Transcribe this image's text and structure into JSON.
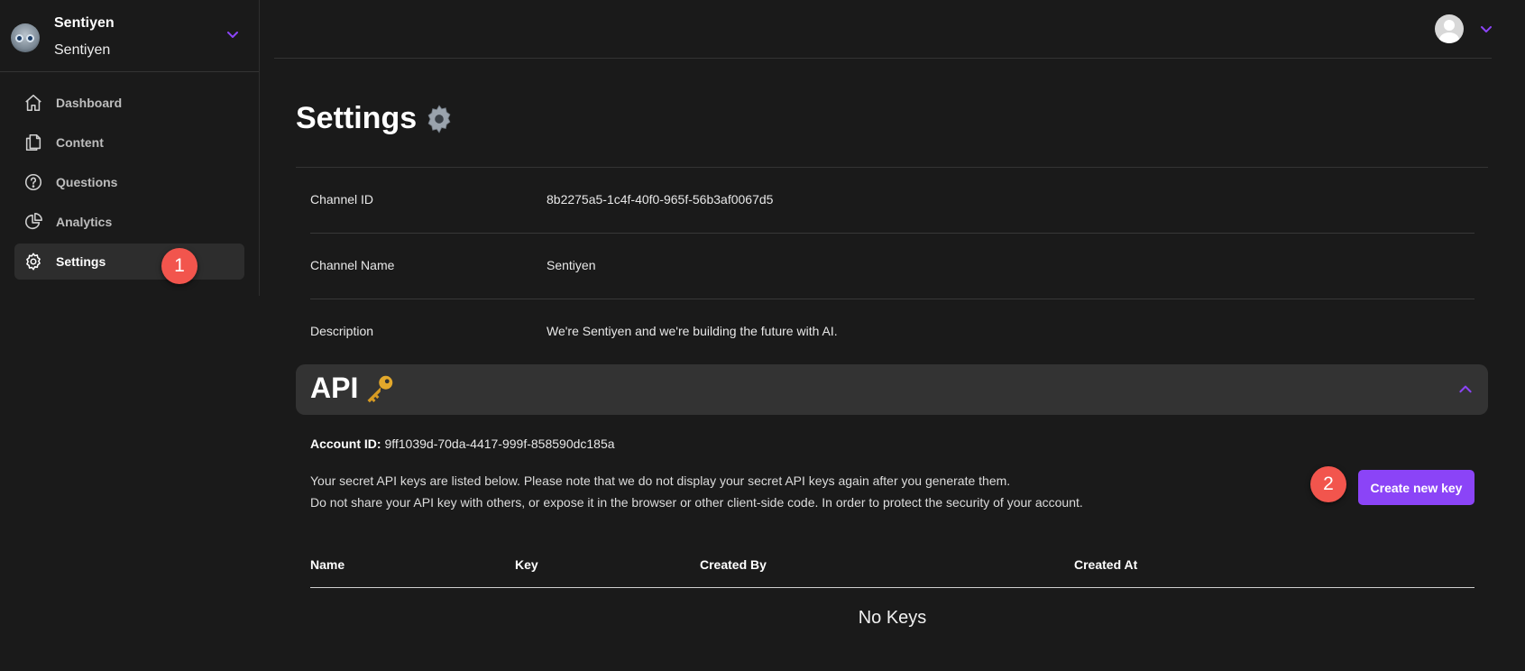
{
  "org": {
    "name": "Sentiyen",
    "subtitle": "Sentiyen"
  },
  "nav": [
    {
      "label": "Dashboard",
      "icon": "home-icon"
    },
    {
      "label": "Content",
      "icon": "files-icon"
    },
    {
      "label": "Questions",
      "icon": "question-circle-icon"
    },
    {
      "label": "Analytics",
      "icon": "pie-chart-icon"
    },
    {
      "label": "Settings",
      "icon": "gear-icon",
      "active": true
    }
  ],
  "annotations": {
    "step1": "1",
    "step2": "2"
  },
  "page": {
    "title": "Settings"
  },
  "fields": [
    {
      "label": "Channel ID",
      "value": "8b2275a5-1c4f-40f0-965f-56b3af0067d5"
    },
    {
      "label": "Channel Name",
      "value": "Sentiyen"
    },
    {
      "label": "Description",
      "value": "We're Sentiyen and we're building the future with AI."
    }
  ],
  "api": {
    "title": "API",
    "account_label": "Account ID:",
    "account_id": "9ff1039d-70da-4417-999f-858590dc185a",
    "desc1": "Your secret API keys are listed below. Please note that we do not display your secret API keys again after you generate them.",
    "desc2": "Do not share your API key with others, or expose it in the browser or other client-side code. In order to protect the security of your account.",
    "create_button": "Create new key",
    "columns": [
      "Name",
      "Key",
      "Created By",
      "Created At"
    ],
    "empty_text": "No Keys"
  },
  "colors": {
    "accent": "#8b44f7",
    "badge": "#f2554d",
    "background": "#1a1a1a",
    "panel": "#333333"
  }
}
